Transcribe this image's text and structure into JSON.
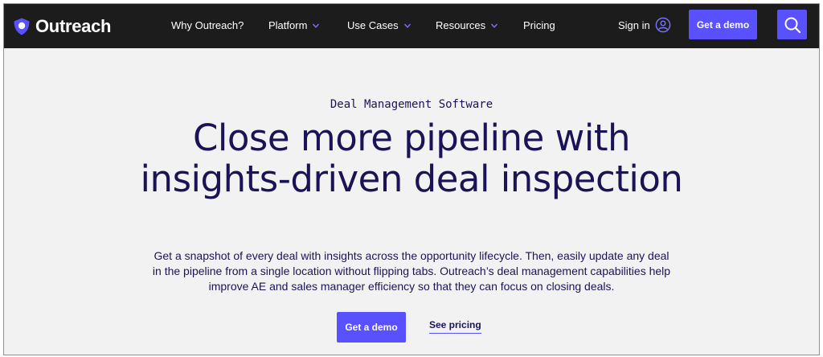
{
  "nav": {
    "logo_text": "Outreach",
    "items": [
      {
        "label": "Why Outreach?"
      },
      {
        "label": "Platform"
      },
      {
        "label": "Use Cases"
      },
      {
        "label": "Resources"
      },
      {
        "label": "Pricing"
      }
    ],
    "signin_label": "Sign in",
    "demo_label": "Get a demo"
  },
  "hero": {
    "eyebrow": "Deal Management Software",
    "headline": "Close more pipeline with insights-driven deal inspection",
    "body": "Get a snapshot of every deal with insights across the opportunity lifecycle. Then, easily update any deal in the pipeline from a single location without flipping tabs. Outreach’s deal management capabilities help improve AE and sales manager efficiency so that they can focus on closing deals.",
    "cta_primary": "Get a demo",
    "cta_secondary": "See pricing"
  },
  "colors": {
    "nav_bg": "#1c1c1c",
    "accent": "#5951ff",
    "text_dark": "#1a1457",
    "page_bg": "#f2f2f2"
  }
}
